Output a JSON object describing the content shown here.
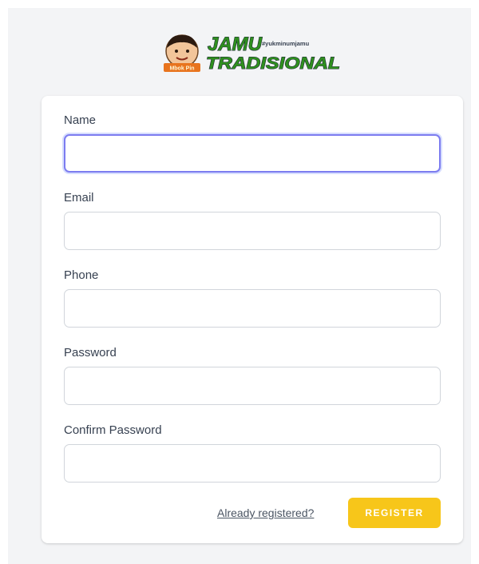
{
  "logo": {
    "line1": "JAMU",
    "tagline": "#yukminumjamu",
    "line2": "TRADISIONAL",
    "badge": "Mbok Pin",
    "colors": {
      "text": "#2f8f1f",
      "outline": "#1f2937",
      "badge": "#e8741e"
    }
  },
  "form": {
    "fields": [
      {
        "label": "Name",
        "value": "",
        "focused": true
      },
      {
        "label": "Email",
        "value": ""
      },
      {
        "label": "Phone",
        "value": ""
      },
      {
        "label": "Password",
        "value": ""
      },
      {
        "label": "Confirm Password",
        "value": ""
      }
    ],
    "login_link": "Already registered?",
    "submit_label": "REGISTER"
  },
  "colors": {
    "accent_button": "#f7c61a",
    "focus_ring": "#7c7cf0",
    "page_bg": "#f3f4f6"
  }
}
